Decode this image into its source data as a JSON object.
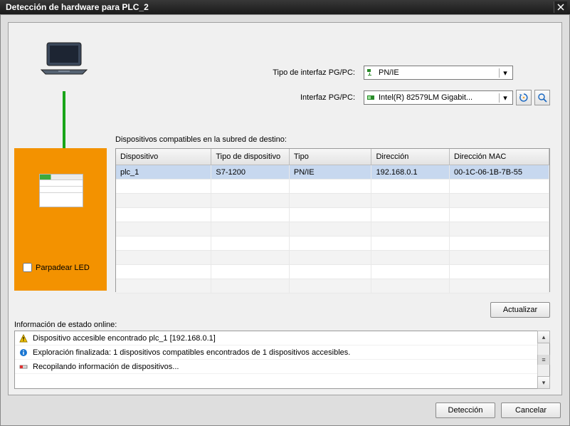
{
  "window": {
    "title": "Detección de hardware para PLC_2"
  },
  "pgpc": {
    "type_label": "Tipo de interfaz PG/PC:",
    "type_value": "PN/IE",
    "interface_label": "Interfaz PG/PC:",
    "interface_value": "Intel(R) 82579LM Gigabit..."
  },
  "section": {
    "compatible_label": "Dispositivos compatibles en la subred de destino:"
  },
  "table": {
    "headers": [
      "Dispositivo",
      "Tipo de dispositivo",
      "Tipo",
      "Dirección",
      "Dirección MAC"
    ],
    "rows": [
      {
        "device": "plc_1",
        "dtype": "S7-1200",
        "type": "PN/IE",
        "addr": "192.168.0.1",
        "mac": "00-1C-06-1B-7B-55"
      }
    ]
  },
  "buttons": {
    "update": "Actualizar",
    "detect": "Detección",
    "cancel": "Cancelar"
  },
  "flash": {
    "label": "Parpadear LED"
  },
  "status": {
    "label": "Información de estado online:",
    "items": [
      {
        "icon": "warn",
        "text": "Dispositivo accesible encontrado plc_1 [192.168.0.1]"
      },
      {
        "icon": "info",
        "text": "Exploración finalizada: 1 dispositivos compatibles encontrados de 1 dispositivos accesibles."
      },
      {
        "icon": "work",
        "text": "Recopilando información de dispositivos..."
      }
    ]
  }
}
